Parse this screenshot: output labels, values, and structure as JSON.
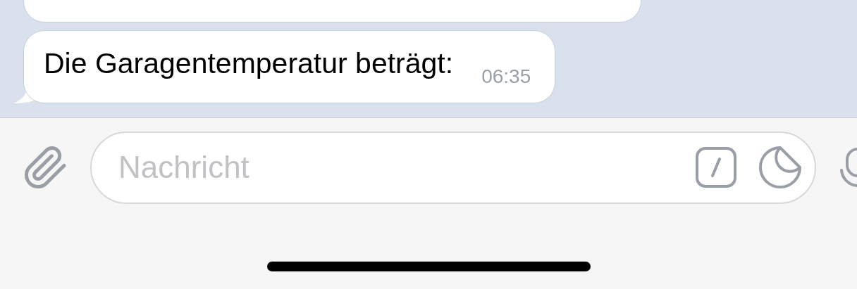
{
  "messages": [
    {
      "text": "Die Garagentemperatur beträgt:",
      "time": "06:35"
    }
  ],
  "composer": {
    "placeholder": "Nachricht"
  }
}
